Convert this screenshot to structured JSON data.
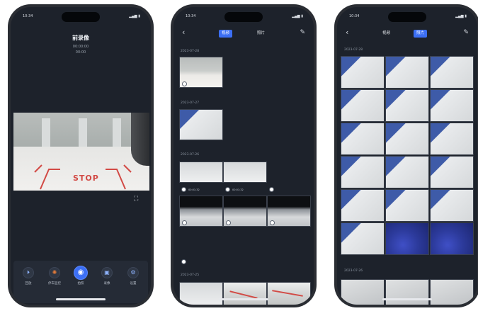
{
  "status_bar": {
    "time": "10:34",
    "signal": "▂▄▆ ▮"
  },
  "phone1": {
    "title": "前录像",
    "subtitle_line1": "00:00:00",
    "subtitle_line2": "00:00",
    "video_overlay_text": "STOP",
    "fullscreen_icon": "expand-icon",
    "toolbar": [
      {
        "label": "回放",
        "icon": "playback-icon",
        "glyph": "⏵"
      },
      {
        "label": "停车监控",
        "icon": "parking-monitor-icon",
        "glyph": "✺"
      },
      {
        "label": "拍照",
        "icon": "camera-icon",
        "glyph": "◉"
      },
      {
        "label": "录像",
        "icon": "record-icon",
        "glyph": "▣"
      },
      {
        "label": "设置",
        "icon": "settings-icon",
        "glyph": "⚙"
      }
    ]
  },
  "phone2": {
    "back_icon": "back-icon",
    "tabs": [
      {
        "label": "视频",
        "selected": true
      },
      {
        "label": "照片",
        "selected": false
      }
    ],
    "edit_icon": "edit-icon",
    "dates": [
      "2023-07-28",
      "2023-07-27",
      "2023-07-26",
      "2023-07-25"
    ],
    "clip_captions": [
      "00:01:32",
      "00:01:32"
    ]
  },
  "phone3": {
    "back_icon": "back-icon",
    "tabs": [
      {
        "label": "视频",
        "selected": false
      },
      {
        "label": "照片",
        "selected": true
      }
    ],
    "edit_icon": "edit-icon",
    "dates": [
      "2023-07-28",
      "2023-07-26"
    ]
  },
  "colors": {
    "accent": "#3c6ff4",
    "screen_bg": "#1d222b",
    "stop_red": "#d24a45"
  }
}
